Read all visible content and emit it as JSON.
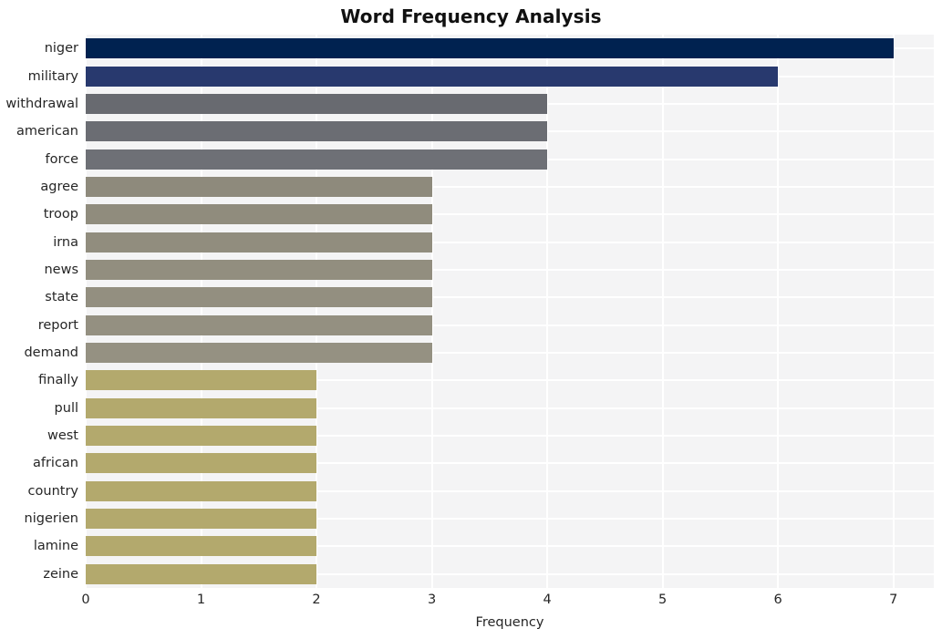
{
  "chart_data": {
    "type": "bar",
    "orientation": "horizontal",
    "title": "Word Frequency Analysis",
    "xlabel": "Frequency",
    "ylabel": "",
    "categories": [
      "niger",
      "military",
      "withdrawal",
      "american",
      "force",
      "agree",
      "troop",
      "irna",
      "news",
      "state",
      "report",
      "demand",
      "finally",
      "pull",
      "west",
      "african",
      "country",
      "nigerien",
      "lamine",
      "zeine"
    ],
    "values": [
      7,
      6,
      4,
      4,
      4,
      3,
      3,
      3,
      3,
      3,
      3,
      3,
      2,
      2,
      2,
      2,
      2,
      2,
      2,
      2
    ],
    "bar_colors": [
      "#002250",
      "#28396e",
      "#686a70",
      "#6b6d73",
      "#6e7076",
      "#8e8a7c",
      "#908c7d",
      "#918d7e",
      "#928e7f",
      "#938f80",
      "#949081",
      "#959182",
      "#b3a96d",
      "#b3a96d",
      "#b3a96d",
      "#b3a96d",
      "#b3a96d",
      "#b3a96d",
      "#b3a96d",
      "#b3a96d"
    ],
    "xticks": [
      0,
      1,
      2,
      3,
      4,
      5,
      6,
      7
    ],
    "xlim": [
      0,
      7.35
    ],
    "grid": true,
    "legend": "none",
    "plot_background": "#f4f4f5",
    "gridline_color": "#ffffff",
    "figure_background": "#ffffff",
    "title_color": "#111111",
    "tick_color": "#262626"
  }
}
